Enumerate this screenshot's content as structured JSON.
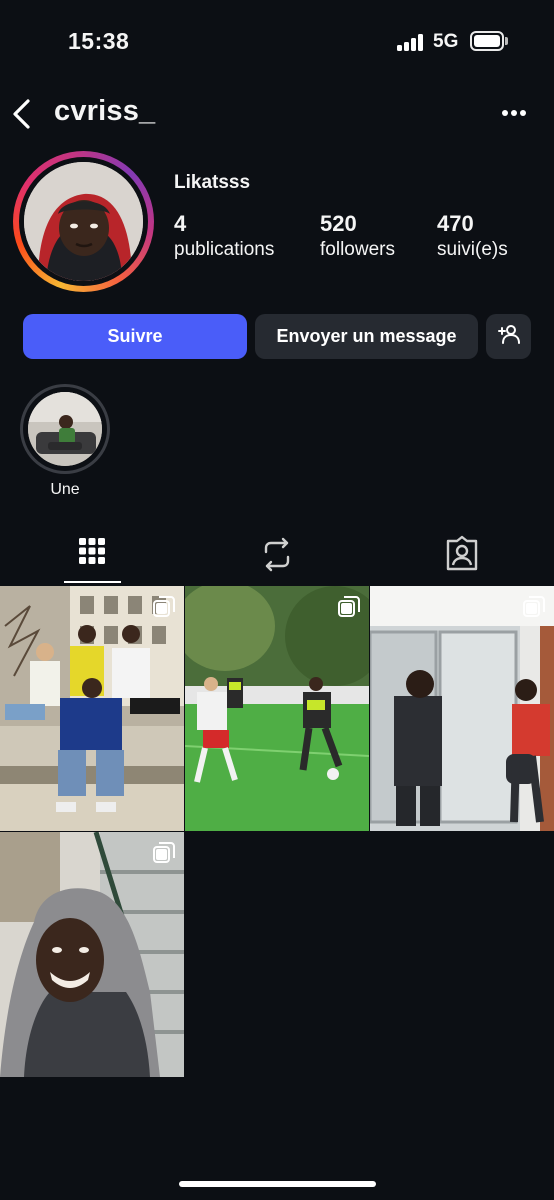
{
  "status_bar": {
    "time": "15:38",
    "network": "5G"
  },
  "header": {
    "username": "cvriss_"
  },
  "profile": {
    "display_name": "Likatsss",
    "stats": [
      {
        "value": "4",
        "label": "publications"
      },
      {
        "value": "520",
        "label": "followers"
      },
      {
        "value": "470",
        "label": "suivi(e)s"
      }
    ]
  },
  "actions": {
    "follow_label": "Suivre",
    "message_label": "Envoyer un message"
  },
  "highlights": [
    {
      "label": "Une"
    }
  ],
  "tabs": [
    {
      "icon": "grid-icon",
      "active": true
    },
    {
      "icon": "reels-repost-icon",
      "active": false
    },
    {
      "icon": "tagged-icon",
      "active": false
    }
  ],
  "colors": {
    "background": "#0c0f14",
    "follow_button": "#4a5df9",
    "secondary_button": "#262a31"
  },
  "posts": [
    {
      "icon": "multiple-photos-icon"
    },
    {
      "icon": "multiple-photos-icon"
    },
    {
      "icon": "multiple-photos-icon"
    },
    {
      "icon": "multiple-photos-icon"
    }
  ]
}
